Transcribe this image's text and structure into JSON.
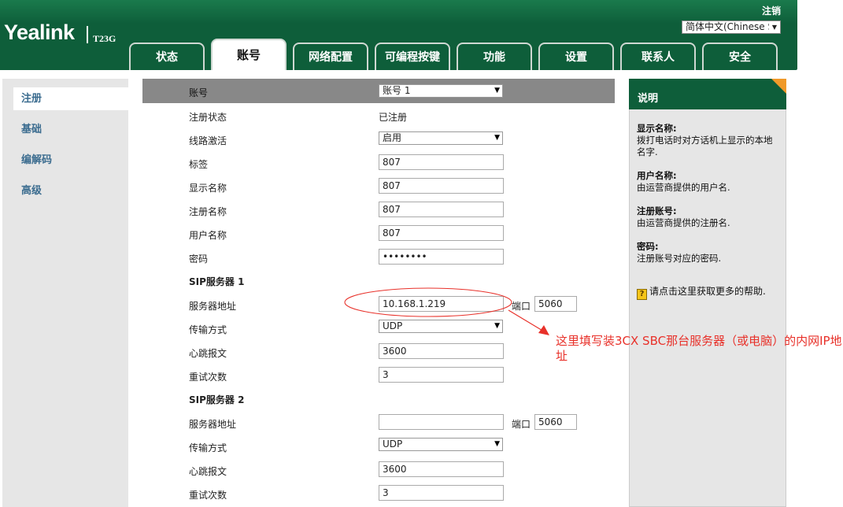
{
  "header": {
    "brand": "Yealink",
    "model": "T23G",
    "logout_label": "注销",
    "language_selected": "简体中文(Chinese S"
  },
  "tabs": [
    {
      "label": "状态",
      "active": false
    },
    {
      "label": "账号",
      "active": true
    },
    {
      "label": "网络配置",
      "active": false
    },
    {
      "label": "可编程按键",
      "active": false
    },
    {
      "label": "功能",
      "active": false
    },
    {
      "label": "设置",
      "active": false
    },
    {
      "label": "联系人",
      "active": false
    },
    {
      "label": "安全",
      "active": false
    }
  ],
  "sidebar": {
    "items": [
      {
        "label": "注册",
        "active": true
      },
      {
        "label": "基础",
        "active": false
      },
      {
        "label": "编解码",
        "active": false
      },
      {
        "label": "高级",
        "active": false
      }
    ]
  },
  "form": {
    "account_label": "账号",
    "account_value": "账号 1",
    "reg_status_label": "注册状态",
    "reg_status_value": "已注册",
    "line_active_label": "线路激活",
    "line_active_value": "启用",
    "tag_label": "标签",
    "tag_value": "807",
    "display_name_label": "显示名称",
    "display_name_value": "807",
    "register_name_label": "注册名称",
    "register_name_value": "807",
    "user_name_label": "用户名称",
    "user_name_value": "807",
    "password_label": "密码",
    "password_value": "••••••••",
    "sip1": {
      "title": "SIP服务器 1",
      "server_label": "服务器地址",
      "server_value": "10.168.1.219",
      "port_label": "端口",
      "port_value": "5060",
      "transport_label": "传输方式",
      "transport_value": "UDP",
      "heartbeat_label": "心跳报文",
      "heartbeat_value": "3600",
      "retry_label": "重试次数",
      "retry_value": "3"
    },
    "sip2": {
      "title": "SIP服务器 2",
      "server_label": "服务器地址",
      "server_value": "",
      "port_label": "端口",
      "port_value": "5060",
      "transport_label": "传输方式",
      "transport_value": "UDP",
      "heartbeat_label": "心跳报文",
      "heartbeat_value": "3600",
      "retry_label": "重试次数",
      "retry_value": "3"
    }
  },
  "help": {
    "title": "说明",
    "blocks": [
      {
        "term": "显示名称:",
        "desc": "拨打电话时对方话机上显示的本地名字."
      },
      {
        "term": "用户名称:",
        "desc": "由运营商提供的用户名."
      },
      {
        "term": "注册账号:",
        "desc": "由运营商提供的注册名."
      },
      {
        "term": "密码:",
        "desc": "注册账号对应的密码."
      }
    ],
    "more": "请点击这里获取更多的帮助."
  },
  "annotation": {
    "text": "这里填写装3CX SBC那台服务器（或电脑）的内网IP地址",
    "color": "#e8312a"
  },
  "colors": {
    "brand_green": "#0e5e3a",
    "panel_gray": "#e6e6e6",
    "form_header_gray": "#888888",
    "help_corner_orange": "#f09a2a",
    "nav_link_blue": "#3b6c8f"
  }
}
